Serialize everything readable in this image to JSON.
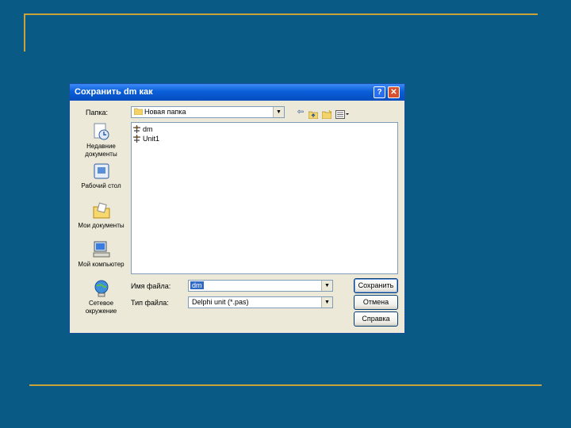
{
  "dialog": {
    "title": "Сохранить dm как",
    "help_button": "?",
    "close_button": "✕"
  },
  "toolbar": {
    "folder_label": "Папка:",
    "folder_value": "Новая папка"
  },
  "places": [
    {
      "label": "Недавние документы",
      "icon": "recent-documents-icon"
    },
    {
      "label": "Рабочий стол",
      "icon": "desktop-icon"
    },
    {
      "label": "Мои документы",
      "icon": "my-documents-icon"
    },
    {
      "label": "Мой компьютер",
      "icon": "my-computer-icon"
    },
    {
      "label": "Сетевое окружение",
      "icon": "network-places-icon"
    }
  ],
  "files": [
    {
      "name": "dm",
      "icon": "project-file-icon"
    },
    {
      "name": "Unit1",
      "icon": "project-file-icon"
    }
  ],
  "form": {
    "filename_label": "Имя файла:",
    "filename_value": "dm",
    "filetype_label": "Тип файла:",
    "filetype_value": "Delphi unit (*.pas)"
  },
  "buttons": {
    "save": "Сохранить",
    "cancel": "Отмена",
    "help": "Справка"
  },
  "colors": {
    "background": "#0a5a86",
    "decor_line": "#c9a23a",
    "titlebar": "#0a5fd8",
    "dialog": "#ece9d8"
  }
}
